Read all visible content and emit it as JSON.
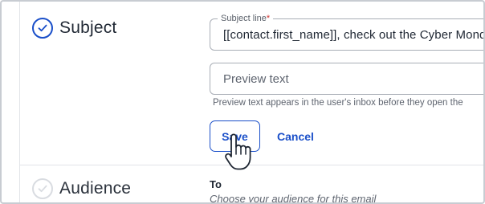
{
  "sections": {
    "subject": {
      "title": "Subject",
      "status": "complete"
    },
    "audience": {
      "title": "Audience",
      "status": "incomplete"
    }
  },
  "subject_form": {
    "subject_line": {
      "label": "Subject line",
      "required_marker": "*",
      "value": "[[contact.first_name]], check out the Cyber Monday"
    },
    "preview_text": {
      "placeholder": "Preview text",
      "value": "",
      "helper": "Preview text appears in the user's inbox before they open the"
    },
    "save_label": "Save",
    "cancel_label": "Cancel"
  },
  "audience_panel": {
    "to_label": "To",
    "description": "Choose your audience for this email"
  },
  "colors": {
    "accent": "#1a4fc9",
    "text": "#1f2733",
    "muted": "#5f6570",
    "border": "#a9aeb6",
    "required": "#d0312d"
  },
  "icons": {
    "subject_status": "check-circle-icon",
    "audience_status": "check-circle-outline-icon",
    "cursor": "hand-pointer-cursor"
  }
}
